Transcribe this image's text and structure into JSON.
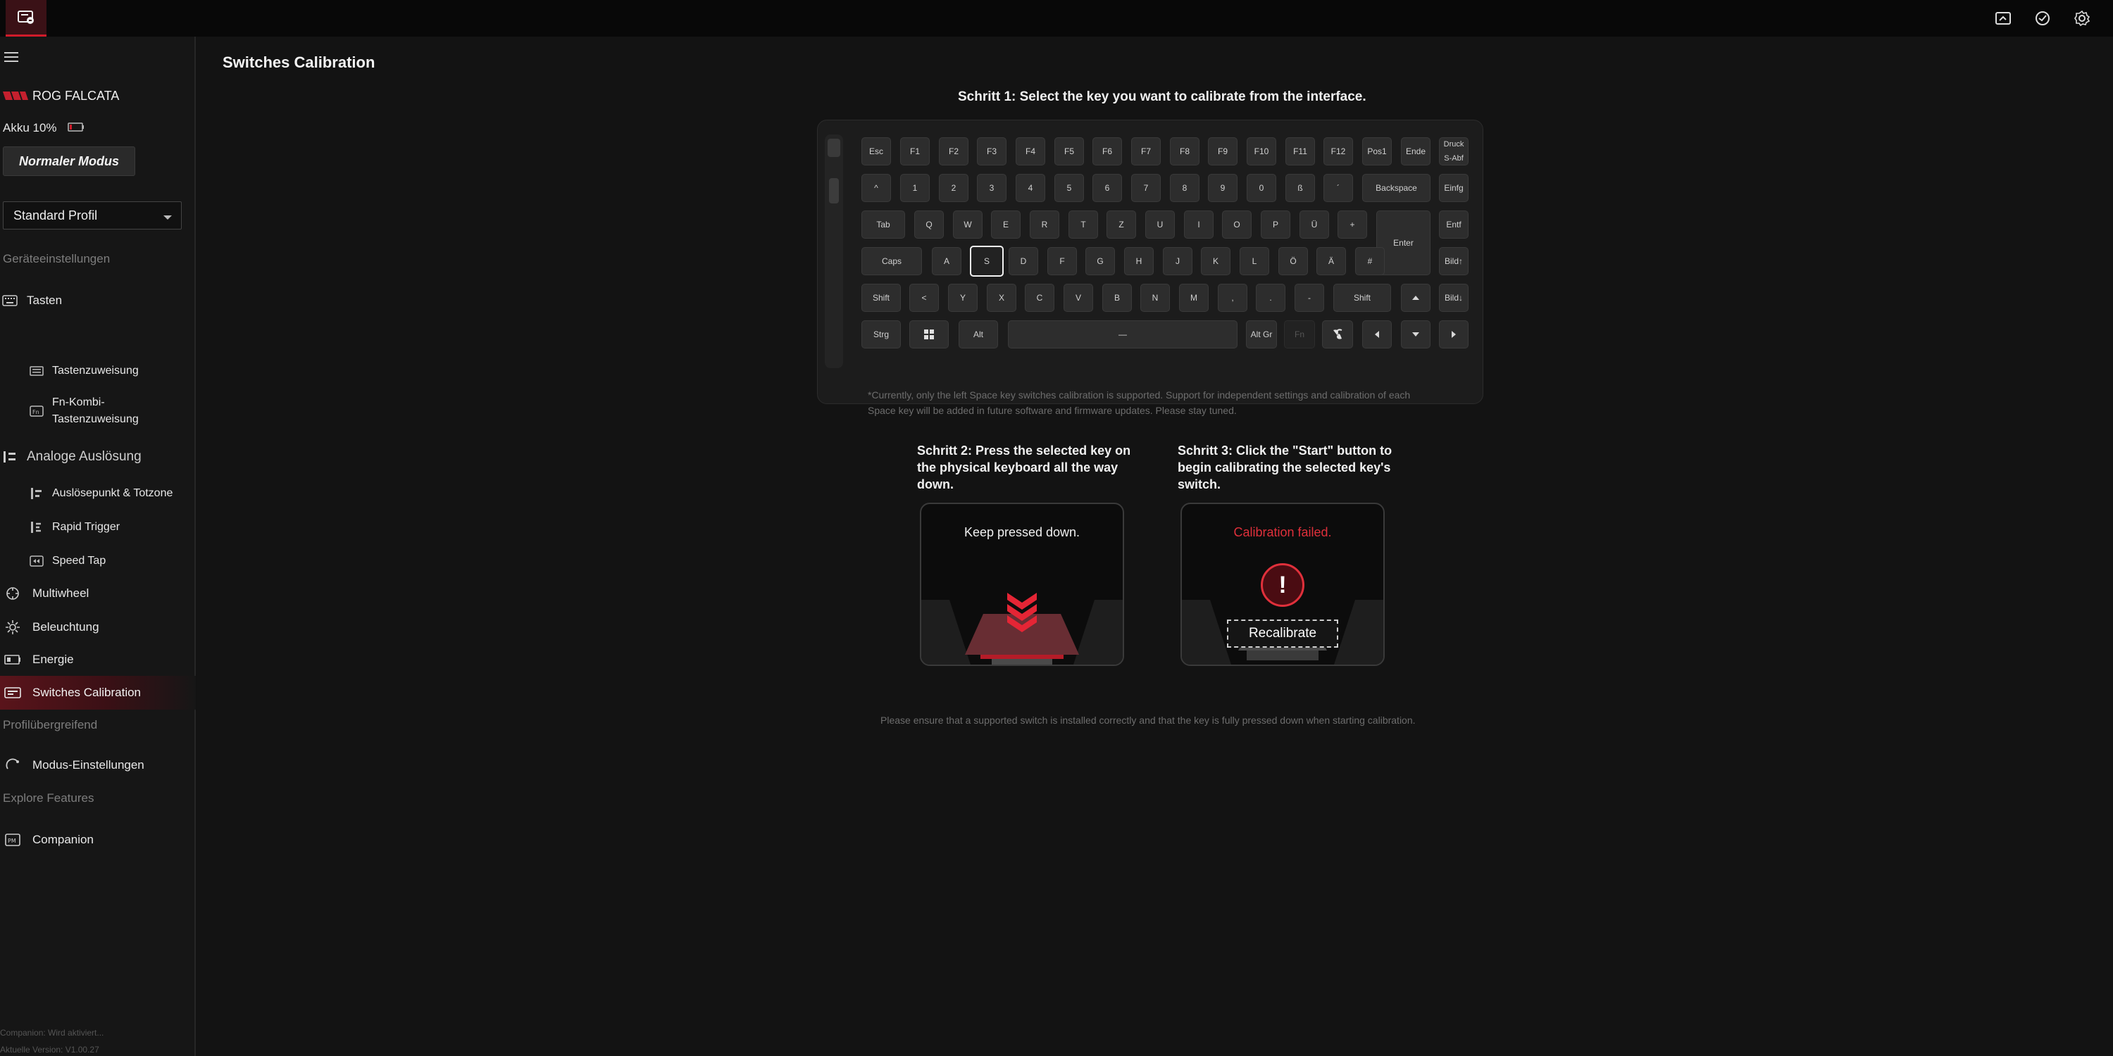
{
  "topbar": {
    "icons": [
      "app-icon",
      "screenshot-icon",
      "sync-icon",
      "settings-icon"
    ]
  },
  "sidebar": {
    "device_name": "ROG FALCATA",
    "battery_label": "Akku 10%",
    "mode_button": "Normaler Modus",
    "profile_select": "Standard Profil",
    "section_device": "Geräteeinstellungen",
    "items": {
      "tasten": "Tasten",
      "tastenzuweisung": "Tastenzuweisung",
      "fn_kombi_line1": "Fn-Kombi-",
      "fn_kombi_line2": "Tastenzuweisung",
      "analoge": "Analoge Auslösung",
      "ausloese": "Auslösepunkt & Totzone",
      "rapid": "Rapid Trigger",
      "speed": "Speed Tap",
      "multiwheel": "Multiwheel",
      "beleuchtung": "Beleuchtung",
      "energie": "Energie",
      "switches": "Switches Calibration",
      "modus": "Modus-Einstellungen",
      "companion": "Companion"
    },
    "section_profile": "Profilübergreifend",
    "section_explore": "Explore Features",
    "footer_status": "Companion: Wird aktiviert...",
    "footer_version": "Aktuelle Version: V1.00.27",
    "accent_color": "#d01b2a"
  },
  "main": {
    "page_title": "Switches Calibration",
    "step1": "Schritt 1: Select the key you want to calibrate from the interface.",
    "keyboard": {
      "row1": [
        "Esc",
        "F1",
        "F2",
        "F3",
        "F4",
        "F5",
        "F6",
        "F7",
        "F8",
        "F9",
        "F10",
        "F11",
        "F12",
        "Pos1",
        "Ende"
      ],
      "druck_top": "Druck",
      "druck_bottom": "S-Abf",
      "row2": [
        "^",
        "1",
        "2",
        "3",
        "4",
        "5",
        "6",
        "7",
        "8",
        "9",
        "0",
        "ß",
        "´",
        "Backspace",
        "Einfg"
      ],
      "row3": [
        "Tab",
        "Q",
        "W",
        "E",
        "R",
        "T",
        "Z",
        "U",
        "I",
        "O",
        "P",
        "Ü",
        "+",
        "Entf"
      ],
      "enter": "Enter",
      "row4": [
        "Caps",
        "A",
        "S",
        "D",
        "F",
        "G",
        "H",
        "J",
        "K",
        "L",
        "Ö",
        "Ä",
        "#",
        "Bild↑"
      ],
      "row5": [
        "Shift",
        "<",
        "Y",
        "X",
        "C",
        "V",
        "B",
        "N",
        "M",
        ",",
        ".",
        "-",
        "Shift",
        "Bild↓"
      ],
      "row6": [
        "Strg",
        "Alt",
        "—",
        "Alt Gr",
        "Fn"
      ],
      "selected_key": "S"
    },
    "footnote_line1": "*Currently, only the left Space key switches calibration is supported. Support for independent settings and calibration of each",
    "footnote_line2": "Space key will be added in future software and firmware updates. Please stay tuned.",
    "step2": "Schritt 2: Press the selected key on the physical keyboard all the way down.",
    "step3": "Schritt 3: Click the \"Start\" button to begin calibrating the selected key's switch.",
    "panel2_text": "Keep pressed down.",
    "panel3_text": "Calibration failed.",
    "recalibrate_button": "Recalibrate",
    "bottom_note": "Please ensure that a supported switch is installed correctly and that the key is fully pressed down when starting calibration.",
    "error_color": "#e0303b"
  }
}
